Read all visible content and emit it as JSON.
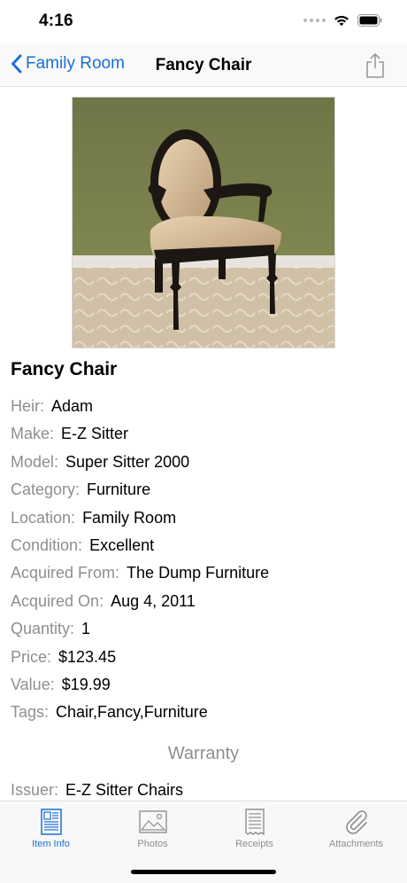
{
  "status_bar": {
    "time": "4:16"
  },
  "nav": {
    "back_label": "Family Room",
    "title": "Fancy Chair"
  },
  "item": {
    "name": "Fancy Chair",
    "details": [
      {
        "label": "Heir:",
        "value": "Adam"
      },
      {
        "label": "Make:",
        "value": "E-Z Sitter"
      },
      {
        "label": "Model:",
        "value": "Super Sitter 2000"
      },
      {
        "label": "Category:",
        "value": "Furniture"
      },
      {
        "label": "Location:",
        "value": "Family Room"
      },
      {
        "label": "Condition:",
        "value": "Excellent"
      },
      {
        "label": "Acquired From:",
        "value": "The Dump Furniture"
      },
      {
        "label": "Acquired On:",
        "value": "Aug 4, 2011"
      },
      {
        "label": "Quantity:",
        "value": "1"
      },
      {
        "label": "Price:",
        "value": "$123.45"
      },
      {
        "label": "Value:",
        "value": "$19.99"
      },
      {
        "label": "Tags:",
        "value": "Chair,Fancy,Furniture"
      }
    ]
  },
  "warranty": {
    "header": "Warranty",
    "issuer_label": "Issuer:",
    "issuer_value": "E-Z Sitter Chairs"
  },
  "tabs": [
    {
      "label": "Item Info",
      "icon": "document-icon",
      "active": true
    },
    {
      "label": "Photos",
      "icon": "photo-icon",
      "active": false
    },
    {
      "label": "Receipts",
      "icon": "receipt-icon",
      "active": false
    },
    {
      "label": "Attachments",
      "icon": "paperclip-icon",
      "active": false
    }
  ],
  "colors": {
    "accent": "#1a6fd4",
    "secondary_text": "#8e8e93"
  }
}
